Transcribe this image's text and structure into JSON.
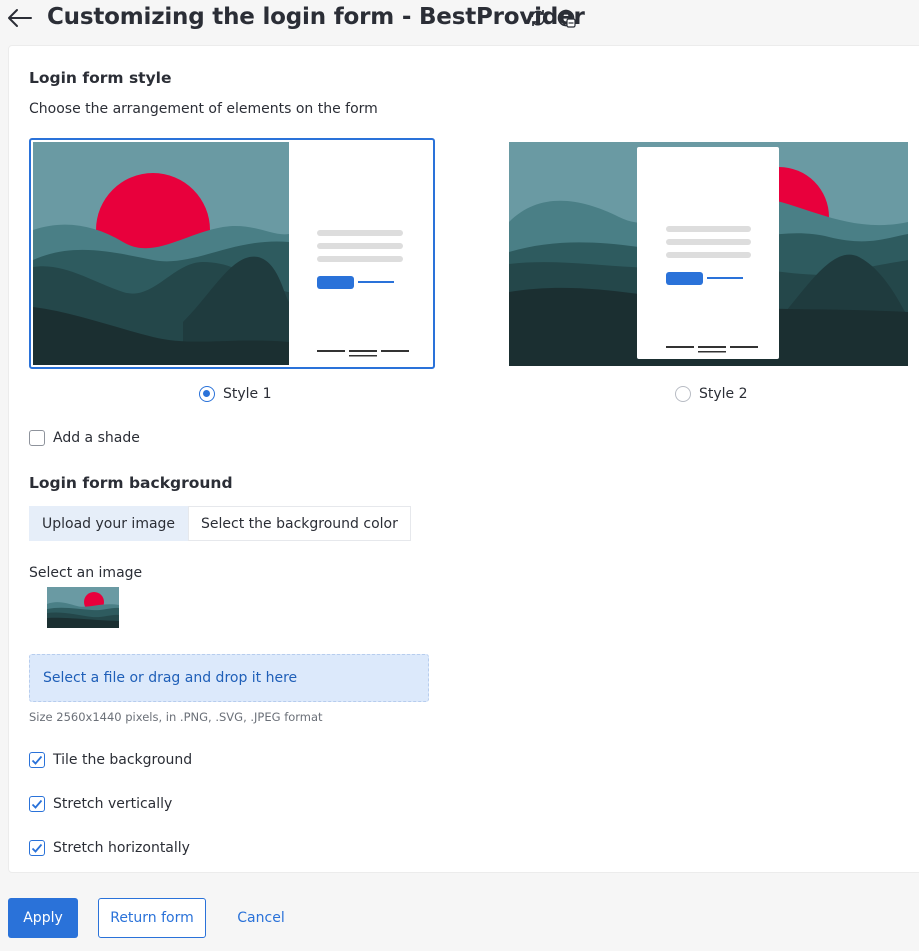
{
  "header": {
    "title": "Customizing the login form - BestProvider",
    "icons": [
      "back-arrow-icon",
      "refresh-icon",
      "globe-icon"
    ]
  },
  "style_section": {
    "title": "Login form style",
    "subtitle": "Choose the arrangement of elements on the form",
    "options": [
      {
        "label": "Style 1",
        "selected": true
      },
      {
        "label": "Style 2",
        "selected": false
      }
    ],
    "shade_label": "Add a shade",
    "shade_checked": false
  },
  "background_section": {
    "title": "Login form background",
    "tabs": [
      {
        "label": "Upload your image",
        "active": true
      },
      {
        "label": "Select the background color",
        "active": false
      }
    ],
    "select_image_label": "Select an image",
    "dropzone_text": "Select a file or drag and drop it here",
    "hint": "Size 2560x1440 pixels, in .PNG, .SVG, .JPEG format",
    "options": [
      {
        "label": "Tile the background",
        "checked": true
      },
      {
        "label": "Stretch vertically",
        "checked": true
      },
      {
        "label": "Stretch horizontally",
        "checked": true
      }
    ]
  },
  "footer": {
    "apply_label": "Apply",
    "return_label": "Return form",
    "cancel_label": "Cancel"
  },
  "colors": {
    "accent": "#2a72d9",
    "sun": "#e8003c",
    "sky": "#6a9aa3"
  }
}
